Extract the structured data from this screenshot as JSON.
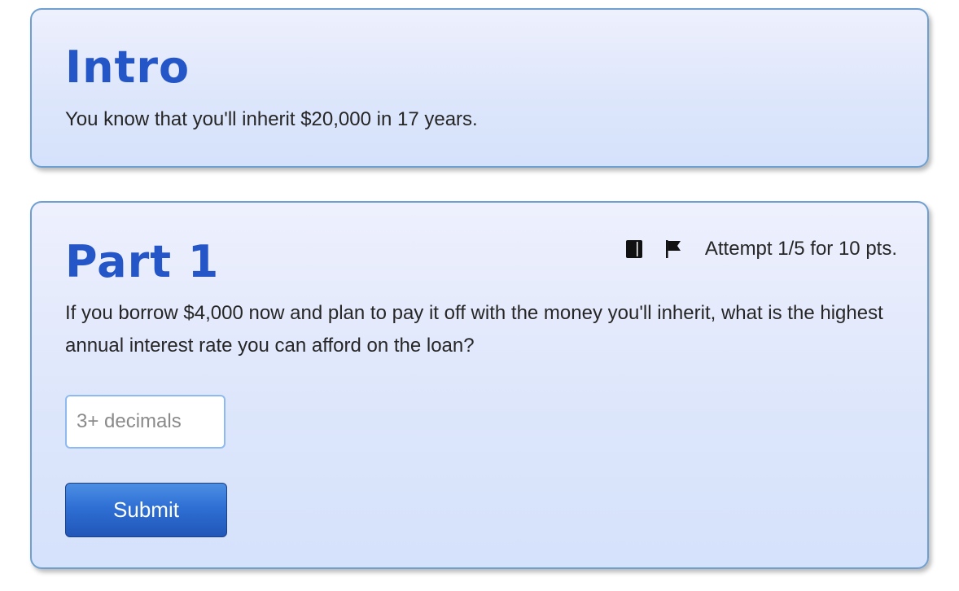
{
  "intro": {
    "title": "Intro",
    "text": "You know that you'll inherit $20,000 in 17 years."
  },
  "part1": {
    "title": "Part 1",
    "attempt_text": "Attempt 1/5 for 10 pts.",
    "question": "If you borrow $4,000 now and plan to pay it off with the money you'll inherit, what is the highest annual interest rate you can afford on the loan?",
    "input": {
      "value": "",
      "placeholder": "3+ decimals"
    },
    "submit_label": "Submit",
    "icons": {
      "reference": "book-icon",
      "report": "flag-icon"
    }
  },
  "colors": {
    "title": "#2456c8",
    "card_border": "#6f9fcf",
    "card_bg_top": "#eef0fd",
    "card_bg_bottom": "#d5e2fb",
    "button": "#2f6fd4",
    "input_border": "#8fbaf0"
  }
}
